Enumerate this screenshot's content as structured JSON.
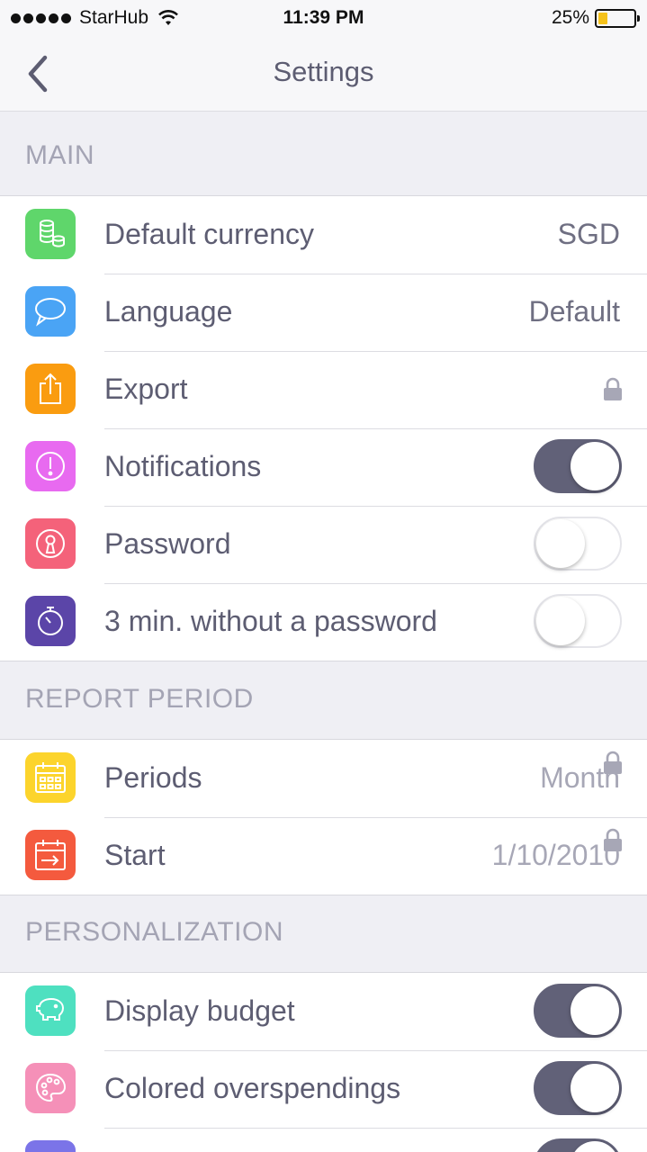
{
  "status_bar": {
    "carrier": "StarHub",
    "time": "11:39 PM",
    "battery": "25%"
  },
  "nav": {
    "title": "Settings",
    "back_icon": "chevron-left-icon"
  },
  "sections": {
    "main": {
      "header": "MAIN",
      "rows": [
        {
          "label": "Default currency",
          "value": "SGD",
          "icon": "coins-icon",
          "color": "#5fd66b"
        },
        {
          "label": "Language",
          "value": "Default",
          "icon": "speech-bubble-icon",
          "color": "#4aa4f5"
        },
        {
          "label": "Export",
          "icon": "share-icon",
          "color": "#fa9c10",
          "locked": true
        },
        {
          "label": "Notifications",
          "icon": "alert-icon",
          "color": "#e86af0",
          "toggle": true
        },
        {
          "label": "Password",
          "icon": "keyhole-icon",
          "color": "#f4627a",
          "toggle": false
        },
        {
          "label": "3 min. without a password",
          "icon": "stopwatch-icon",
          "color": "#5b45a8",
          "toggle": false
        }
      ]
    },
    "report_period": {
      "header": "REPORT PERIOD",
      "rows": [
        {
          "label": "Periods",
          "value": "Month",
          "icon": "calendar-icon",
          "color": "#fcd42c",
          "locked": true
        },
        {
          "label": "Start",
          "value": "1/10/2010",
          "icon": "calendar-arrow-icon",
          "color": "#f45a3e",
          "locked": true
        }
      ]
    },
    "personalization": {
      "header": "PERSONALIZATION",
      "rows": [
        {
          "label": "Display budget",
          "icon": "piggy-bank-icon",
          "color": "#4ee0c0",
          "toggle": true
        },
        {
          "label": "Colored overspendings",
          "icon": "palette-icon",
          "color": "#f590b8",
          "toggle": true
        },
        {
          "label": "",
          "icon": "partial-icon",
          "color": "#7b74e8",
          "toggle": true
        }
      ]
    }
  }
}
